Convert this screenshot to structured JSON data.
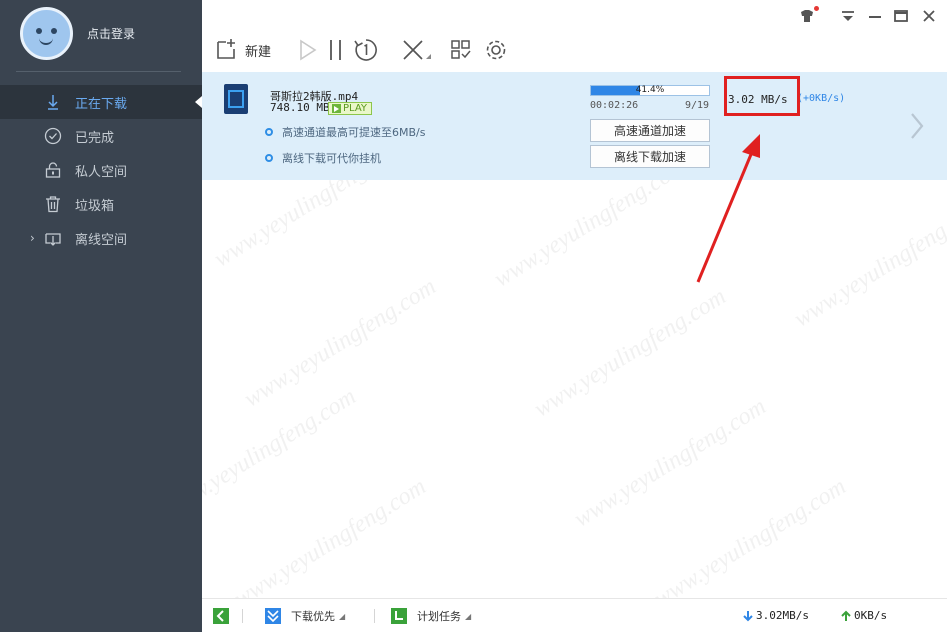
{
  "sidebar": {
    "login_label": "点击登录",
    "items": [
      {
        "label": "正在下载",
        "icon": "download-icon",
        "active": true
      },
      {
        "label": "已完成",
        "icon": "check-circle-icon"
      },
      {
        "label": "私人空间",
        "icon": "lock-icon"
      },
      {
        "label": "垃圾箱",
        "icon": "trash-icon"
      },
      {
        "label": "离线空间",
        "icon": "offline-download-icon",
        "expandable": true
      }
    ]
  },
  "toolbar": {
    "new_label": "新建",
    "icons": [
      "new-task-icon",
      "start-icon",
      "pause-icon",
      "limit-speed-icon",
      "delete-icon",
      "grid-view-icon",
      "settings-icon"
    ]
  },
  "window_controls": [
    "skin-icon",
    "menu-icon",
    "minimize-icon",
    "maximize-icon",
    "close-icon"
  ],
  "task": {
    "file_name": "哥斯拉2韩版.mp4",
    "file_size": "748.10 MB",
    "play_label": "PLAY",
    "tip_fast": "高速通道最高可提速至6MB/s",
    "tip_offline": "离线下载可代你挂机",
    "progress_pct": "41.4%",
    "progress_value": 41.4,
    "elapsed": "00:02:26",
    "pieces": "9/19",
    "btn_fast": "高速通道加速",
    "btn_offline": "离线下载加速",
    "speed": "3.02  MB/s",
    "speed_extra": "(+0KB/s)"
  },
  "statusbar": {
    "priority_label": "下载优先",
    "schedule_label": "计划任务",
    "down_speed": "3.02MB/s",
    "up_speed": "0KB/s"
  },
  "watermark": "www.yeyulingfeng.com",
  "colors": {
    "sidebar_bg": "#3a4450",
    "accent": "#2f86e6",
    "task_row_bg": "#ddeefa",
    "highlight": "#e02020"
  }
}
